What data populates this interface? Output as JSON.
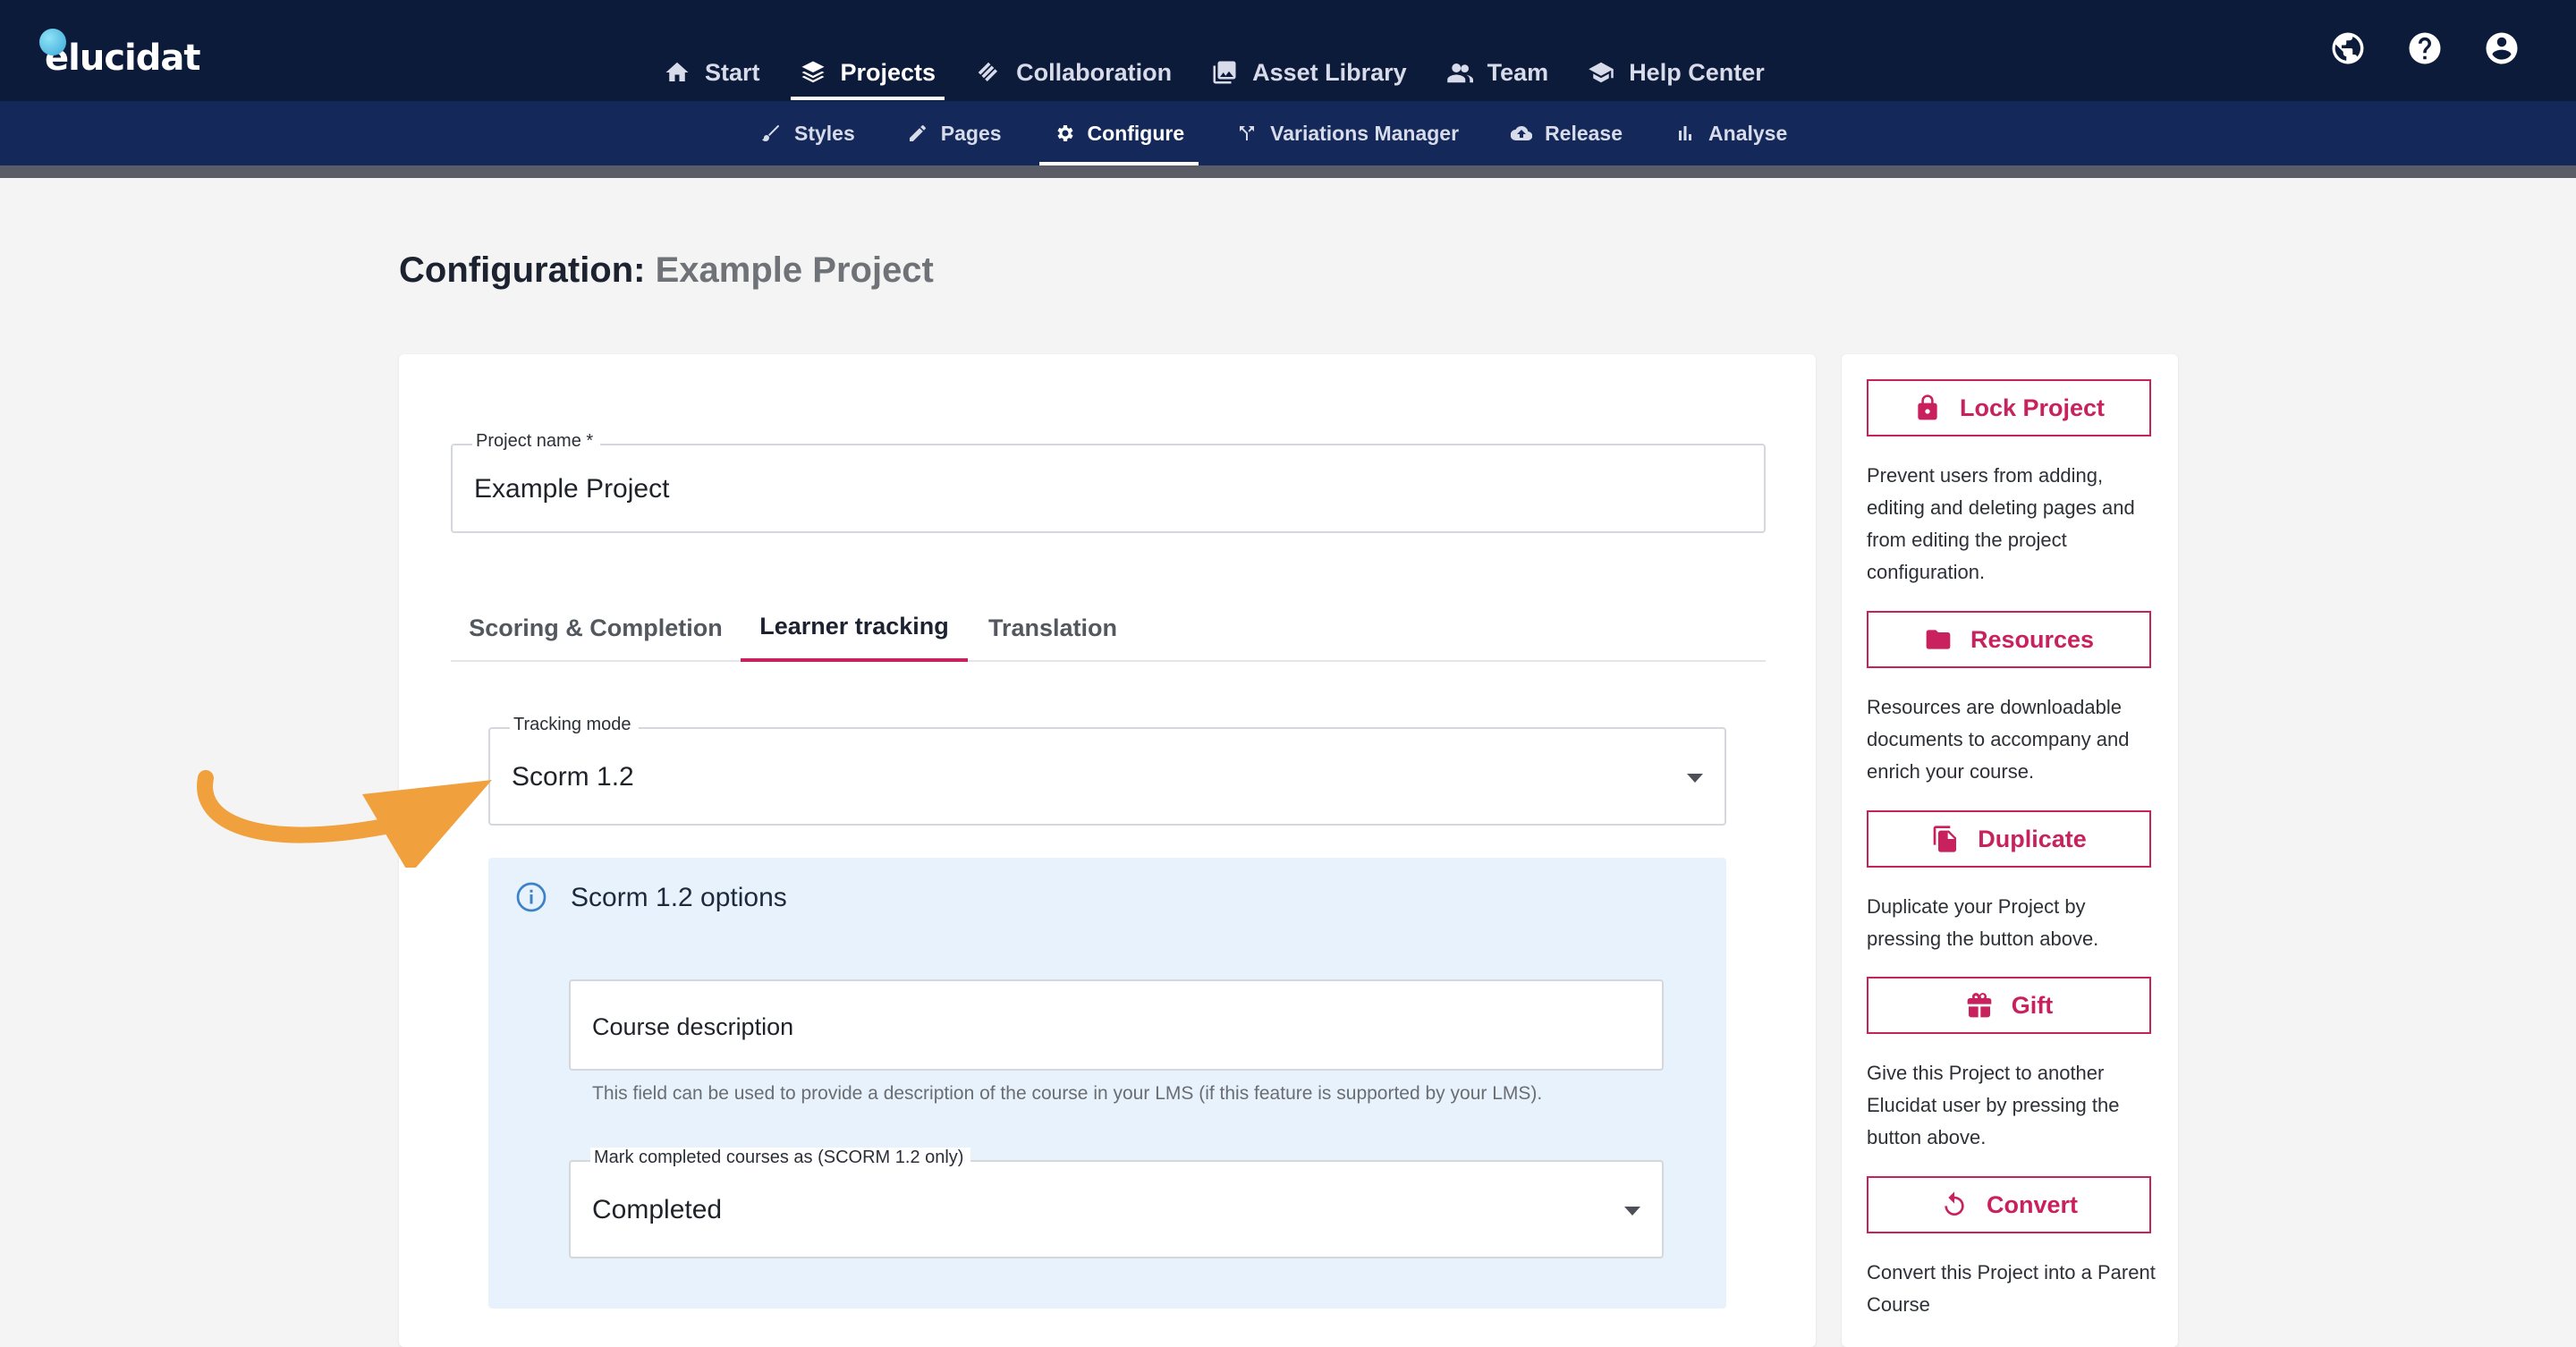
{
  "app": {
    "logo_text": "elucidat"
  },
  "main_nav": [
    {
      "label": "Start",
      "icon": "home-icon",
      "active": false
    },
    {
      "label": "Projects",
      "icon": "layers-icon",
      "active": true
    },
    {
      "label": "Collaboration",
      "icon": "collaboration-icon",
      "active": false
    },
    {
      "label": "Asset Library",
      "icon": "image-library-icon",
      "active": false
    },
    {
      "label": "Team",
      "icon": "team-icon",
      "active": false
    },
    {
      "label": "Help Center",
      "icon": "graduation-cap-icon",
      "active": false
    }
  ],
  "utility_icons": [
    "globe-icon",
    "help-icon",
    "account-icon"
  ],
  "sub_nav": [
    {
      "label": "Styles",
      "icon": "brush-icon",
      "active": false
    },
    {
      "label": "Pages",
      "icon": "pencil-icon",
      "active": false
    },
    {
      "label": "Configure",
      "icon": "gear-icon",
      "active": true
    },
    {
      "label": "Variations Manager",
      "icon": "variations-icon",
      "active": false
    },
    {
      "label": "Release",
      "icon": "cloud-upload-icon",
      "active": false
    },
    {
      "label": "Analyse",
      "icon": "bar-chart-icon",
      "active": false
    }
  ],
  "page": {
    "title_prefix": "Configuration:",
    "title_project": "Example Project"
  },
  "form": {
    "project_name_label": "Project name *",
    "project_name_value": "Example Project",
    "tabs": [
      {
        "label": "Scoring & Completion",
        "active": false
      },
      {
        "label": "Learner tracking",
        "active": true
      },
      {
        "label": "Translation",
        "active": false
      }
    ],
    "tracking_mode_label": "Tracking mode",
    "tracking_mode_value": "Scorm 1.2",
    "scorm_panel_title": "Scorm 1.2 options",
    "course_description_placeholder": "Course description",
    "course_description_helper": "This field can be used to provide a description of the course in your LMS (if this feature is supported by your LMS).",
    "mark_completed_label": "Mark completed courses as (SCORM 1.2 only)",
    "mark_completed_value": "Completed"
  },
  "sidebar": [
    {
      "label": "Lock Project",
      "icon": "lock-icon",
      "description": "Prevent users from adding, editing and deleting pages and from editing the project configuration."
    },
    {
      "label": "Resources",
      "icon": "folder-icon",
      "description": "Resources are downloadable documents to accompany and enrich your course."
    },
    {
      "label": "Duplicate",
      "icon": "duplicate-icon",
      "description": "Duplicate your Project by pressing the button above."
    },
    {
      "label": "Gift",
      "icon": "gift-icon",
      "description": "Give this Project to another Elucidat user by pressing the button above."
    },
    {
      "label": "Convert",
      "icon": "convert-icon",
      "description": "Convert this Project into a Parent Course"
    }
  ],
  "colors": {
    "nav_bg": "#0d1b3a",
    "subnav_bg": "#14295a",
    "accent": "#c8215d",
    "info_panel_bg": "#e8f2fc",
    "annotation_arrow": "#f0a03c"
  }
}
